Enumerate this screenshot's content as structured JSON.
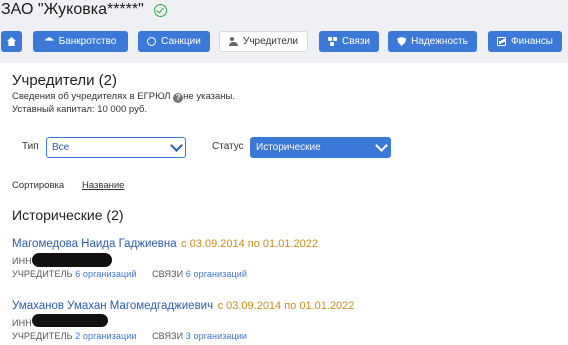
{
  "company": {
    "name": "ЗАО \"Жуковка*****\"",
    "verified_icon": "check-circle-icon",
    "accent": "#2eaa4a"
  },
  "nav": {
    "home_icon": "home-icon",
    "items": [
      {
        "label": "Банкротство",
        "icon": "bank-icon"
      },
      {
        "label": "Санкции",
        "icon": "globe-icon"
      },
      {
        "label": "Учредители",
        "icon": "users-icon",
        "active": true
      },
      {
        "label": "Связи",
        "icon": "links-icon"
      },
      {
        "label": "Надежность",
        "icon": "shield-icon"
      },
      {
        "label": "Финансы",
        "icon": "chart-icon"
      }
    ],
    "color": "#3c78d8"
  },
  "founders": {
    "title": "Учредители (2)",
    "egrul_note_prefix": "Сведения об учредителях в ЕГРЮЛ",
    "egrul_note_suffix": "не указаны.",
    "help_glyph": "?",
    "capital": "Уставный капитал: 10 000 руб."
  },
  "filters": {
    "type_label": "Тип",
    "type_value": "Все",
    "status_label": "Статус",
    "status_value": "Исторические"
  },
  "sort": {
    "label": "Сортировка",
    "value": "Название"
  },
  "historic": {
    "heading": "Исторические (2)",
    "people": [
      {
        "name": "Магомедова Наида Гаджиевна",
        "dates": "с 03.09.2014 по 01.01.2022",
        "inn_label": "ИНН",
        "founder_label": "УЧРЕДИТЕЛЬ",
        "founder_link": "6 организаций",
        "links_label": "СВЯЗИ",
        "links_link": "6 организаций"
      },
      {
        "name": "Умаханов Умахан Магомедгаджиевич",
        "dates": "с 03.09.2014 по 01.01.2022",
        "inn_label": "ИНН",
        "founder_label": "УЧРЕДИТЕЛЬ",
        "founder_link": "2 организации",
        "links_label": "СВЯЗИ",
        "links_link": "3 организации"
      }
    ]
  }
}
